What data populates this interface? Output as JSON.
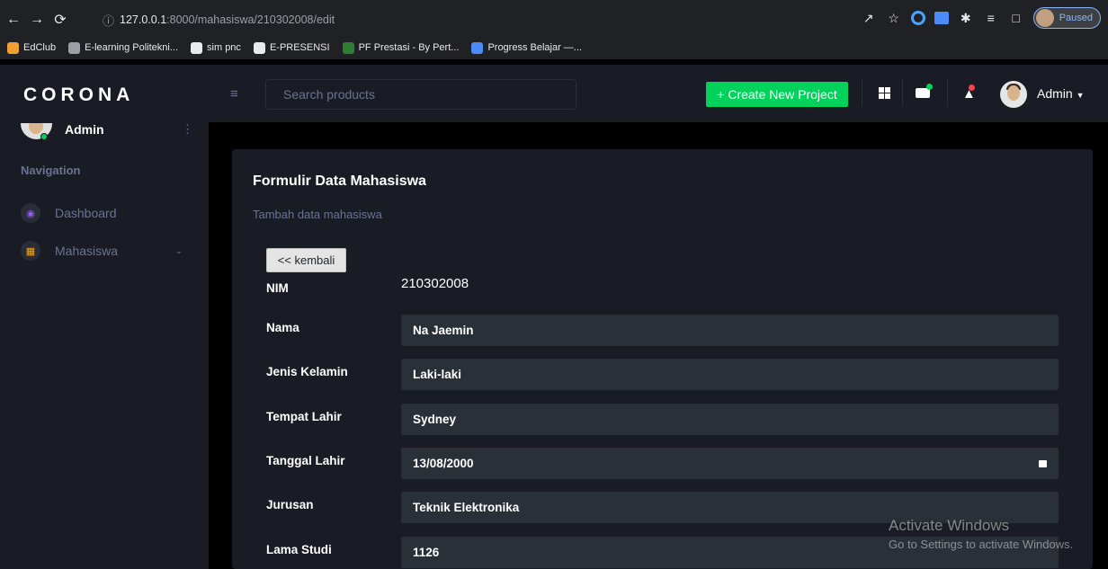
{
  "browser": {
    "url_host": "127.0.0.1",
    "url_rest": ":8000/mahasiswa/210302008/edit",
    "paused_label": "Paused",
    "bookmarks": [
      {
        "label": "EdClub",
        "color": "#f0a030"
      },
      {
        "label": "E-learning Politekni...",
        "color": "#9aa0a6"
      },
      {
        "label": "sim pnc",
        "color": "#e8eaed"
      },
      {
        "label": "E-PRESENSI",
        "color": "#e8eaed"
      },
      {
        "label": "PF Prestasi - By Pert...",
        "color": "#2e7d32"
      },
      {
        "label": "Progress Belajar —...",
        "color": "#4c8bf5"
      }
    ]
  },
  "navbar": {
    "brand": "CORONA",
    "search_placeholder": "Search products",
    "create_button": "+ Create New Project",
    "user_label": "Admin"
  },
  "sidebar": {
    "profile_name": "Admin",
    "nav_heading": "Navigation",
    "items": [
      {
        "label": "Dashboard",
        "icon": "speedometer-icon",
        "icon_color": "#8f5fe8"
      },
      {
        "label": "Mahasiswa",
        "icon": "table-icon",
        "icon_color": "#ffab00"
      }
    ]
  },
  "form": {
    "title": "Formulir Data Mahasiswa",
    "description": "Tambah data mahasiswa",
    "back_button": "<< kembali",
    "nim_label": "NIM",
    "nim_value": "210302008",
    "fields": [
      {
        "label": "Nama",
        "value": "Na Jaemin"
      },
      {
        "label": "Jenis Kelamin",
        "value": "Laki-laki"
      },
      {
        "label": "Tempat Lahir",
        "value": "Sydney"
      },
      {
        "label": "Tanggal Lahir",
        "value": "13/08/2000"
      },
      {
        "label": "Jurusan",
        "value": "Teknik Elektronika"
      },
      {
        "label": "Lama Studi",
        "value": "1126"
      }
    ]
  },
  "watermark": {
    "line1": "Activate Windows",
    "line2": "Go to Settings to activate Windows."
  },
  "colors": {
    "accent_green": "#00d25b",
    "panel": "#191c24",
    "input_bg": "#2a3038"
  }
}
